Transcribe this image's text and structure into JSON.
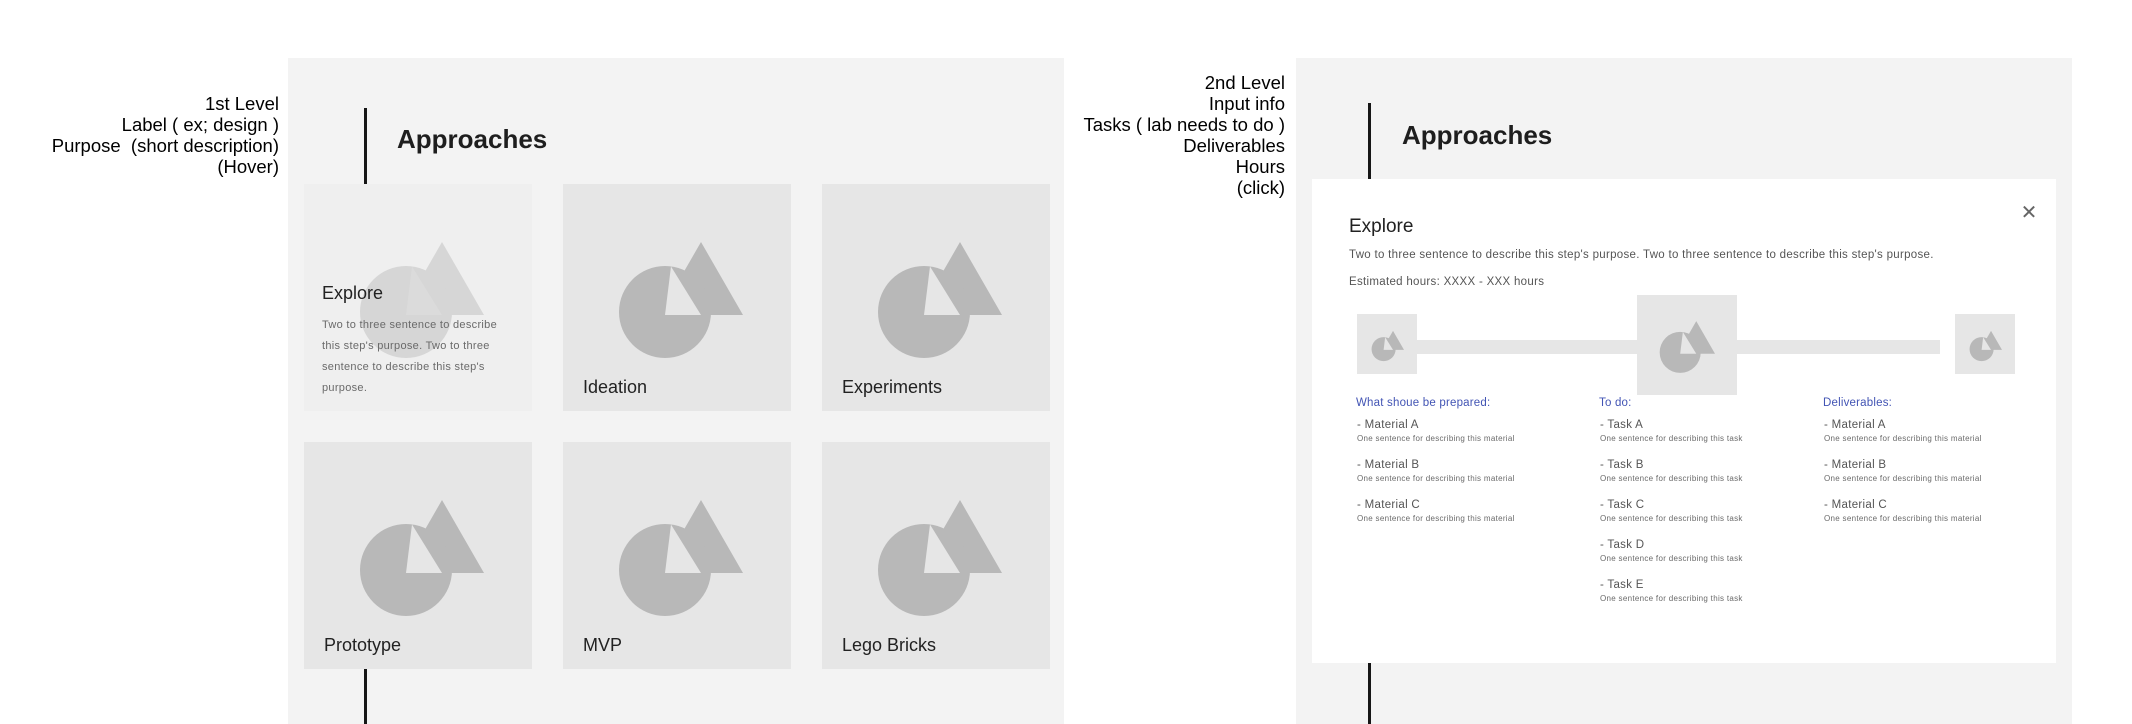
{
  "annotations": {
    "left": [
      "1st Level",
      "Label ( ex; design )",
      "Purpose  (short description)",
      "(Hover)"
    ],
    "right": [
      "2nd Level",
      "Input info",
      "Tasks ( lab needs to do )",
      "Deliverables",
      "Hours",
      "(click)"
    ]
  },
  "left_panel": {
    "heading": "Approaches",
    "cards": [
      {
        "label": "Explore",
        "hover": true,
        "description": "Two to three sentence to describe this step's purpose. Two to three sentence to describe this step's purpose."
      },
      {
        "label": "Ideation"
      },
      {
        "label": "Experiments"
      },
      {
        "label": "Prototype"
      },
      {
        "label": "MVP"
      },
      {
        "label": "Lego Bricks"
      }
    ]
  },
  "right_panel": {
    "heading": "Approaches",
    "modal": {
      "title": "Explore",
      "close_icon": "close-icon",
      "purpose": "Two to three sentence to describe this step's purpose. Two to three sentence to describe this step's purpose.",
      "hours": "Estimated hours: XXXX - XXX hours",
      "columns": [
        {
          "heading": "What shoue be prepared:",
          "items": [
            {
              "name": "- Material A",
              "desc": "One sentence for describing this material"
            },
            {
              "name": "- Material B",
              "desc": "One sentence for describing this material"
            },
            {
              "name": "- Material C",
              "desc": "One sentence for describing this material"
            }
          ]
        },
        {
          "heading": "To do:",
          "items": [
            {
              "name": "- Task A",
              "desc": "One sentence for describing this task"
            },
            {
              "name": "- Task B",
              "desc": "One sentence for describing this task"
            },
            {
              "name": "- Task C",
              "desc": "One sentence for describing this task"
            },
            {
              "name": "- Task D",
              "desc": "One sentence for describing this task"
            },
            {
              "name": "- Task E",
              "desc": "One sentence for describing this task"
            }
          ]
        },
        {
          "heading": "Deliverables:",
          "items": [
            {
              "name": "- Material A",
              "desc": "One sentence for describing this material"
            },
            {
              "name": "- Material B",
              "desc": "One sentence for describing this material"
            },
            {
              "name": "- Material C",
              "desc": "One sentence for describing this material"
            }
          ]
        }
      ]
    }
  },
  "colors": {
    "panel": "#f3f3f3",
    "card": "#e6e6e6",
    "shape": "#b8b8b8",
    "accent": "#4254b4"
  }
}
